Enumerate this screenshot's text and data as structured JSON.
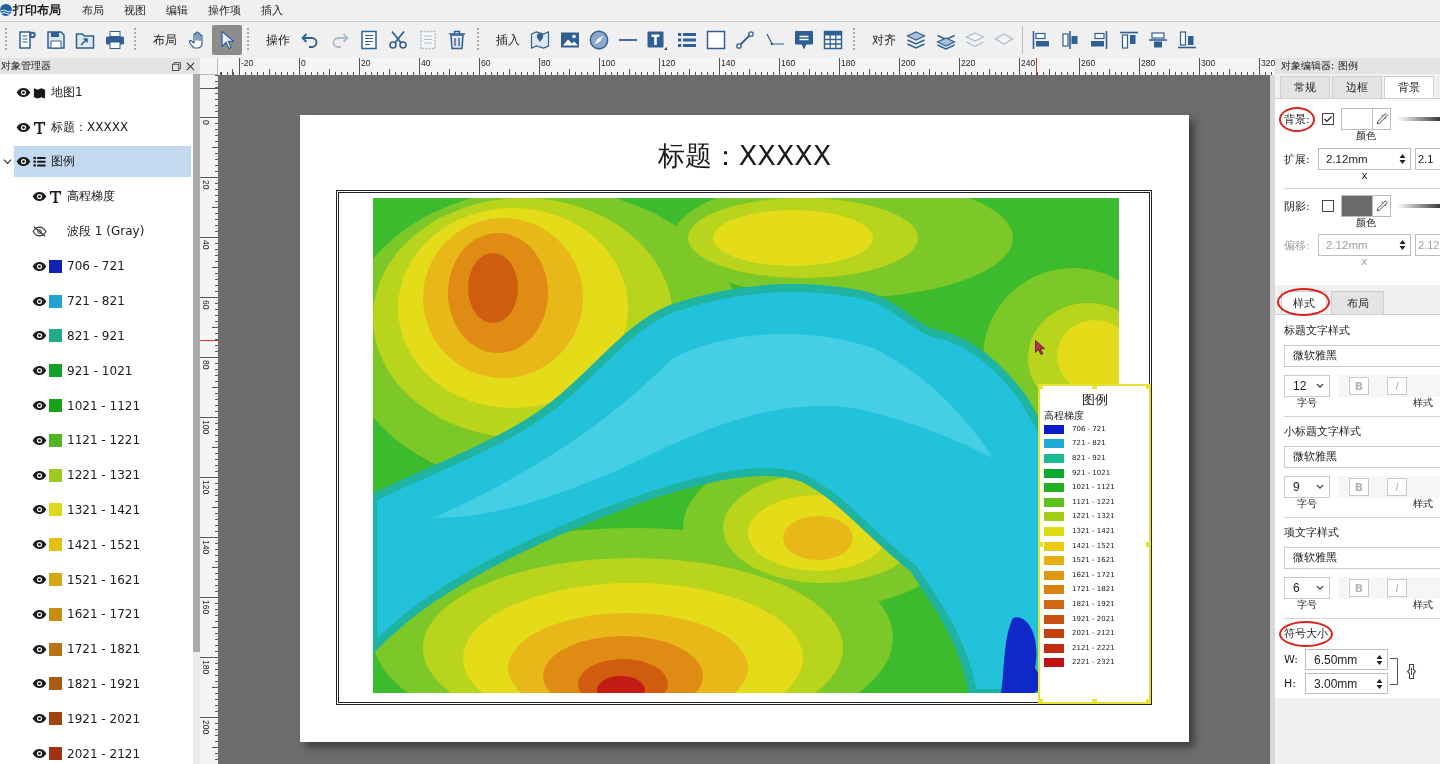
{
  "window": {
    "title": "打印布局"
  },
  "menu": [
    "布局",
    "视图",
    "编辑",
    "操作项",
    "插入"
  ],
  "toolbar": [
    {
      "kind": "grip",
      "buttons": [
        {
          "kind": "page",
          "selected": false,
          "disabled": false
        },
        {
          "kind": "save",
          "selected": false,
          "disabled": false
        },
        {
          "kind": "export",
          "selected": false,
          "disabled": false
        },
        {
          "kind": "print",
          "selected": false,
          "disabled": false
        }
      ]
    },
    {
      "kind": "grip",
      "label": "布局",
      "buttons": [
        {
          "kind": "pan",
          "selected": false,
          "disabled": false
        },
        {
          "kind": "select",
          "selected": true,
          "disabled": false
        }
      ]
    },
    {
      "kind": "grip",
      "label": "操作",
      "buttons": [
        {
          "kind": "undo",
          "selected": false,
          "disabled": false
        },
        {
          "kind": "redo",
          "selected": false,
          "disabled": true
        },
        {
          "kind": "copy",
          "selected": false,
          "disabled": false
        },
        {
          "kind": "cut",
          "selected": false,
          "disabled": false
        },
        {
          "kind": "paste",
          "selected": false,
          "disabled": true
        },
        {
          "kind": "delete",
          "selected": false,
          "disabled": false
        }
      ]
    },
    {
      "kind": "grip",
      "label": "插入",
      "buttons": [
        {
          "kind": "map",
          "selected": false,
          "disabled": false
        },
        {
          "kind": "image",
          "selected": false,
          "disabled": false
        },
        {
          "kind": "compass",
          "selected": false,
          "disabled": false
        },
        {
          "kind": "line",
          "selected": false,
          "disabled": false
        },
        {
          "kind": "text",
          "selected": false,
          "disabled": false
        },
        {
          "kind": "legend",
          "selected": false,
          "disabled": false
        },
        {
          "kind": "rectangle",
          "selected": false,
          "disabled": false
        },
        {
          "kind": "segment",
          "selected": false,
          "disabled": false
        },
        {
          "kind": "polyline",
          "selected": false,
          "disabled": false
        },
        {
          "kind": "callout",
          "selected": false,
          "disabled": false
        },
        {
          "kind": "table",
          "selected": false,
          "disabled": false
        }
      ]
    },
    {
      "kind": "grip",
      "label": "对齐",
      "buttons": [
        {
          "kind": "layer-up",
          "selected": false,
          "disabled": false
        },
        {
          "kind": "layer-down",
          "selected": false,
          "disabled": false
        },
        {
          "kind": "layer-bottom",
          "selected": false,
          "disabled": true
        },
        {
          "kind": "layer-top",
          "selected": false,
          "disabled": true
        }
      ]
    },
    {
      "kind": "line",
      "buttons": [
        {
          "kind": "align-left",
          "selected": false,
          "disabled": false
        },
        {
          "kind": "align-hcenter",
          "selected": false,
          "disabled": false
        },
        {
          "kind": "align-right",
          "selected": false,
          "disabled": false
        },
        {
          "kind": "align-top",
          "selected": false,
          "disabled": false
        },
        {
          "kind": "align-vcenter",
          "selected": false,
          "disabled": false
        },
        {
          "kind": "align-bottom",
          "selected": false,
          "disabled": false
        }
      ]
    }
  ],
  "rulers": {
    "horizontal": [
      "-20",
      "0",
      "20",
      "40",
      "60",
      "80",
      "100",
      "120",
      "140",
      "160",
      "180",
      "200",
      "220",
      "240",
      "260",
      "280",
      "300",
      "320"
    ],
    "vertical": [
      "0",
      "20",
      "40",
      "60",
      "80",
      "100",
      "120",
      "140",
      "160",
      "180",
      "200"
    ]
  },
  "object_manager": {
    "title": "对象管理器",
    "items": [
      {
        "kind": "map",
        "label": "地图1",
        "visible": true,
        "selected": false
      },
      {
        "kind": "text",
        "label": "标题：XXXXX",
        "visible": true,
        "selected": false
      },
      {
        "kind": "legend",
        "label": "图例",
        "visible": true,
        "selected": true,
        "expanded": true,
        "children": [
          {
            "kind": "text",
            "label": "高程梯度",
            "visible": true,
            "selected": false
          },
          {
            "kind": "band",
            "label": "波段 1 (Gray)",
            "visible": false,
            "selected": false
          },
          {
            "kind": "class",
            "label": "706 - 721",
            "color": "#1422b4",
            "visible": true,
            "selected": false
          },
          {
            "kind": "class",
            "label": "721 - 821",
            "color": "#22a2d2",
            "visible": true,
            "selected": false
          },
          {
            "kind": "class",
            "label": "821 - 921",
            "color": "#1faa88",
            "visible": true,
            "selected": false
          },
          {
            "kind": "class",
            "label": "921 - 1021",
            "color": "#14a028",
            "visible": true,
            "selected": false
          },
          {
            "kind": "class",
            "label": "1021 - 1121",
            "color": "#18a018",
            "visible": true,
            "selected": false
          },
          {
            "kind": "class",
            "label": "1121 - 1221",
            "color": "#52b624",
            "visible": true,
            "selected": false
          },
          {
            "kind": "class",
            "label": "1221 - 1321",
            "color": "#9ec822",
            "visible": true,
            "selected": false
          },
          {
            "kind": "class",
            "label": "1321 - 1421",
            "color": "#dcd81e",
            "visible": true,
            "selected": false
          },
          {
            "kind": "class",
            "label": "1421 - 1521",
            "color": "#e2c014",
            "visible": true,
            "selected": false
          },
          {
            "kind": "class",
            "label": "1521 - 1621",
            "color": "#d8a814",
            "visible": true,
            "selected": false
          },
          {
            "kind": "class",
            "label": "1621 - 1721",
            "color": "#c88c14",
            "visible": true,
            "selected": false
          },
          {
            "kind": "class",
            "label": "1721 - 1821",
            "color": "#b87414",
            "visible": true,
            "selected": false
          },
          {
            "kind": "class",
            "label": "1821 - 1921",
            "color": "#aa5a12",
            "visible": true,
            "selected": false
          },
          {
            "kind": "class",
            "label": "1921 - 2021",
            "color": "#a24412",
            "visible": true,
            "selected": false
          },
          {
            "kind": "class",
            "label": "2021 - 2121",
            "color": "#a03210",
            "visible": true,
            "selected": false
          }
        ]
      }
    ]
  },
  "page": {
    "title": "标题：XXXXX",
    "legend": {
      "title": "图例",
      "subtitle": "高程梯度",
      "selected": true,
      "items": [
        {
          "label": "706 - 721",
          "color": "#0c1ccc"
        },
        {
          "label": "721 - 821",
          "color": "#1caad8"
        },
        {
          "label": "821 - 921",
          "color": "#1cba92"
        },
        {
          "label": "921 - 1021",
          "color": "#0caa32"
        },
        {
          "label": "1021 - 1121",
          "color": "#22b022"
        },
        {
          "label": "1121 - 1221",
          "color": "#60c022"
        },
        {
          "label": "1221 - 1321",
          "color": "#a2cc12"
        },
        {
          "label": "1321 - 1421",
          "color": "#dcdc12"
        },
        {
          "label": "1421 - 1521",
          "color": "#ecca12"
        },
        {
          "label": "1521 - 1621",
          "color": "#e6b012"
        },
        {
          "label": "1621 - 1721",
          "color": "#e09812"
        },
        {
          "label": "1721 - 1821",
          "color": "#d88012"
        },
        {
          "label": "1821 - 1921",
          "color": "#d06812"
        },
        {
          "label": "1921 - 2021",
          "color": "#c85012"
        },
        {
          "label": "2021 - 2121",
          "color": "#c84012"
        },
        {
          "label": "2121 - 2221",
          "color": "#c02c12"
        },
        {
          "label": "2221 - 2321",
          "color": "#c01212"
        }
      ]
    }
  },
  "object_editor": {
    "title": "对象编辑器: 图例",
    "tabs": [
      {
        "label": "常规",
        "selected": false
      },
      {
        "label": "边框",
        "selected": false
      },
      {
        "label": "背景",
        "selected": true
      }
    ],
    "background": {
      "label": "背景:",
      "checked": true,
      "circled": true,
      "color": "#ffffff",
      "caption": "颜色"
    },
    "expand": {
      "label": "扩展:",
      "value": "2.12mm",
      "caption": "x",
      "value_2": "2.1"
    },
    "shadow": {
      "label": "阴影:",
      "checked": false,
      "color": "#6b6b6b",
      "caption": "颜色"
    },
    "offset": {
      "label": "偏移:",
      "value": "2.12mm",
      "caption": "x",
      "value_2": "2.12",
      "disabled": true
    },
    "style_tabs": [
      {
        "label": "样式",
        "selected": true,
        "circled": true
      },
      {
        "label": "布局",
        "selected": false,
        "circled": false
      }
    ],
    "text_styles": [
      {
        "heading": "标题文字样式",
        "font": "微软雅黑",
        "size": "12",
        "size_caption": "字号",
        "bold": "B",
        "italic": "I",
        "buttons_disabled": true,
        "style_caption": "样式"
      },
      {
        "heading": "小标题文字样式",
        "font": "微软雅黑",
        "size": "9",
        "size_caption": "字号",
        "bold": "B",
        "italic": "I",
        "buttons_disabled": true,
        "style_caption": "样式"
      },
      {
        "heading": "项文字样式",
        "font": "微软雅黑",
        "size": "6",
        "size_caption": "字号",
        "bold": "B",
        "italic": "I",
        "buttons_disabled": true,
        "style_caption": "样式"
      }
    ],
    "symbol_size": {
      "heading": "符号大小",
      "circled": true,
      "width_label": "W:",
      "width": "6.50mm",
      "height_label": "H:",
      "height": "3.00mm"
    }
  }
}
